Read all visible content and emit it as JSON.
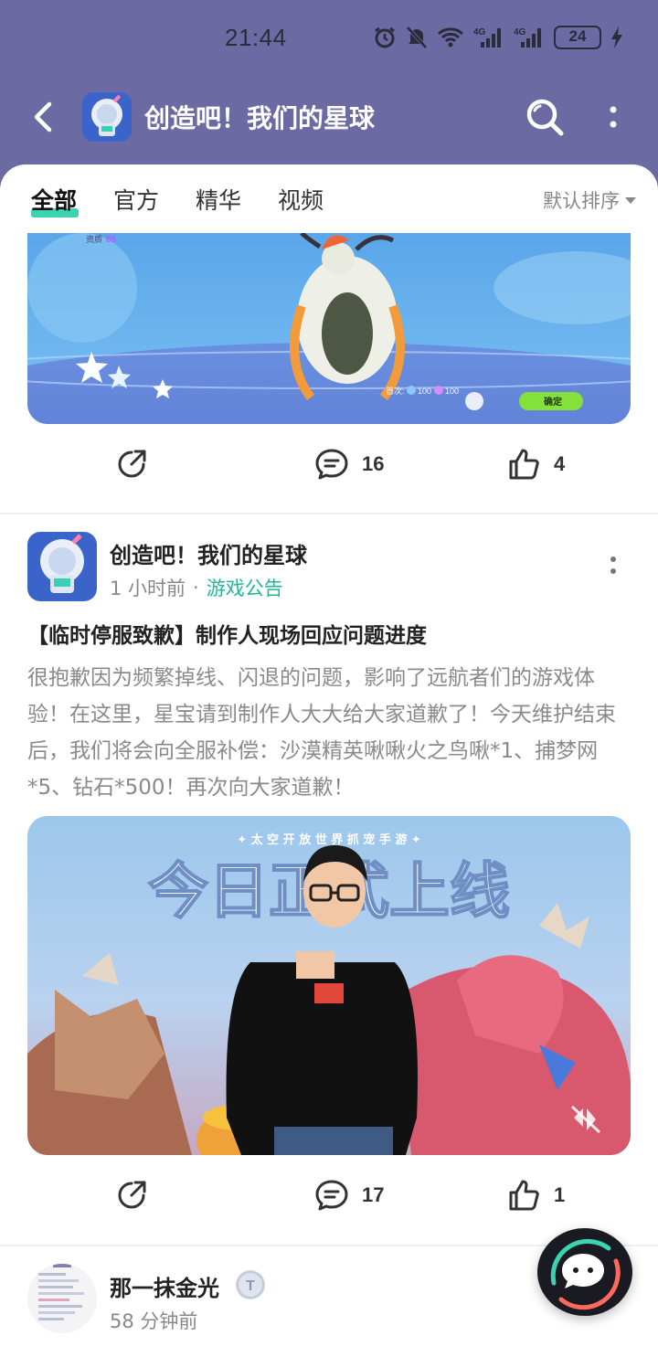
{
  "status_bar": {
    "time": "21:44",
    "battery": "24"
  },
  "header": {
    "title": "创造吧！我们的星球"
  },
  "tabs": [
    {
      "label": "全部",
      "active": true
    },
    {
      "label": "官方",
      "active": false
    },
    {
      "label": "精华",
      "active": false
    },
    {
      "label": "视频",
      "active": false
    }
  ],
  "sort": {
    "label": "默认排序"
  },
  "post1": {
    "game_ui": {
      "quality_label": "资质",
      "quality_value": "85",
      "first_label": "首次:",
      "cost_a": "100",
      "cost_b": "100",
      "confirm_label": "确定"
    },
    "actions": {
      "share": "",
      "comments": "16",
      "likes": "4"
    }
  },
  "post2": {
    "author": "创造吧！我们的星球",
    "time": "1 小时前",
    "separator": "·",
    "tag": "游戏公告",
    "title": "【临时停服致歉】制作人现场回应问题进度",
    "body": "很抱歉因为频繁掉线、闪退的问题，影响了远航者们的游戏体验！在这里，星宝请到制作人大大给大家道歉了！今天维护结束后，我们将会向全服补偿：沙漠精英啾啾火之鸟啾*1、捕梦网*5、钻石*500！再次向大家道歉！",
    "image_subtitle": "✦ 太 空 开 放 世 界 抓 宠 手 游 ✦",
    "image_headline": "今日正式上线",
    "actions": {
      "comments": "17",
      "likes": "1"
    }
  },
  "post3": {
    "author": "那一抹金光",
    "badge": "T",
    "time": "58 分钟前"
  },
  "colors": {
    "header_bg": "#6b6aa3",
    "accent": "#3bd4b0",
    "tag": "#1fb89a"
  }
}
